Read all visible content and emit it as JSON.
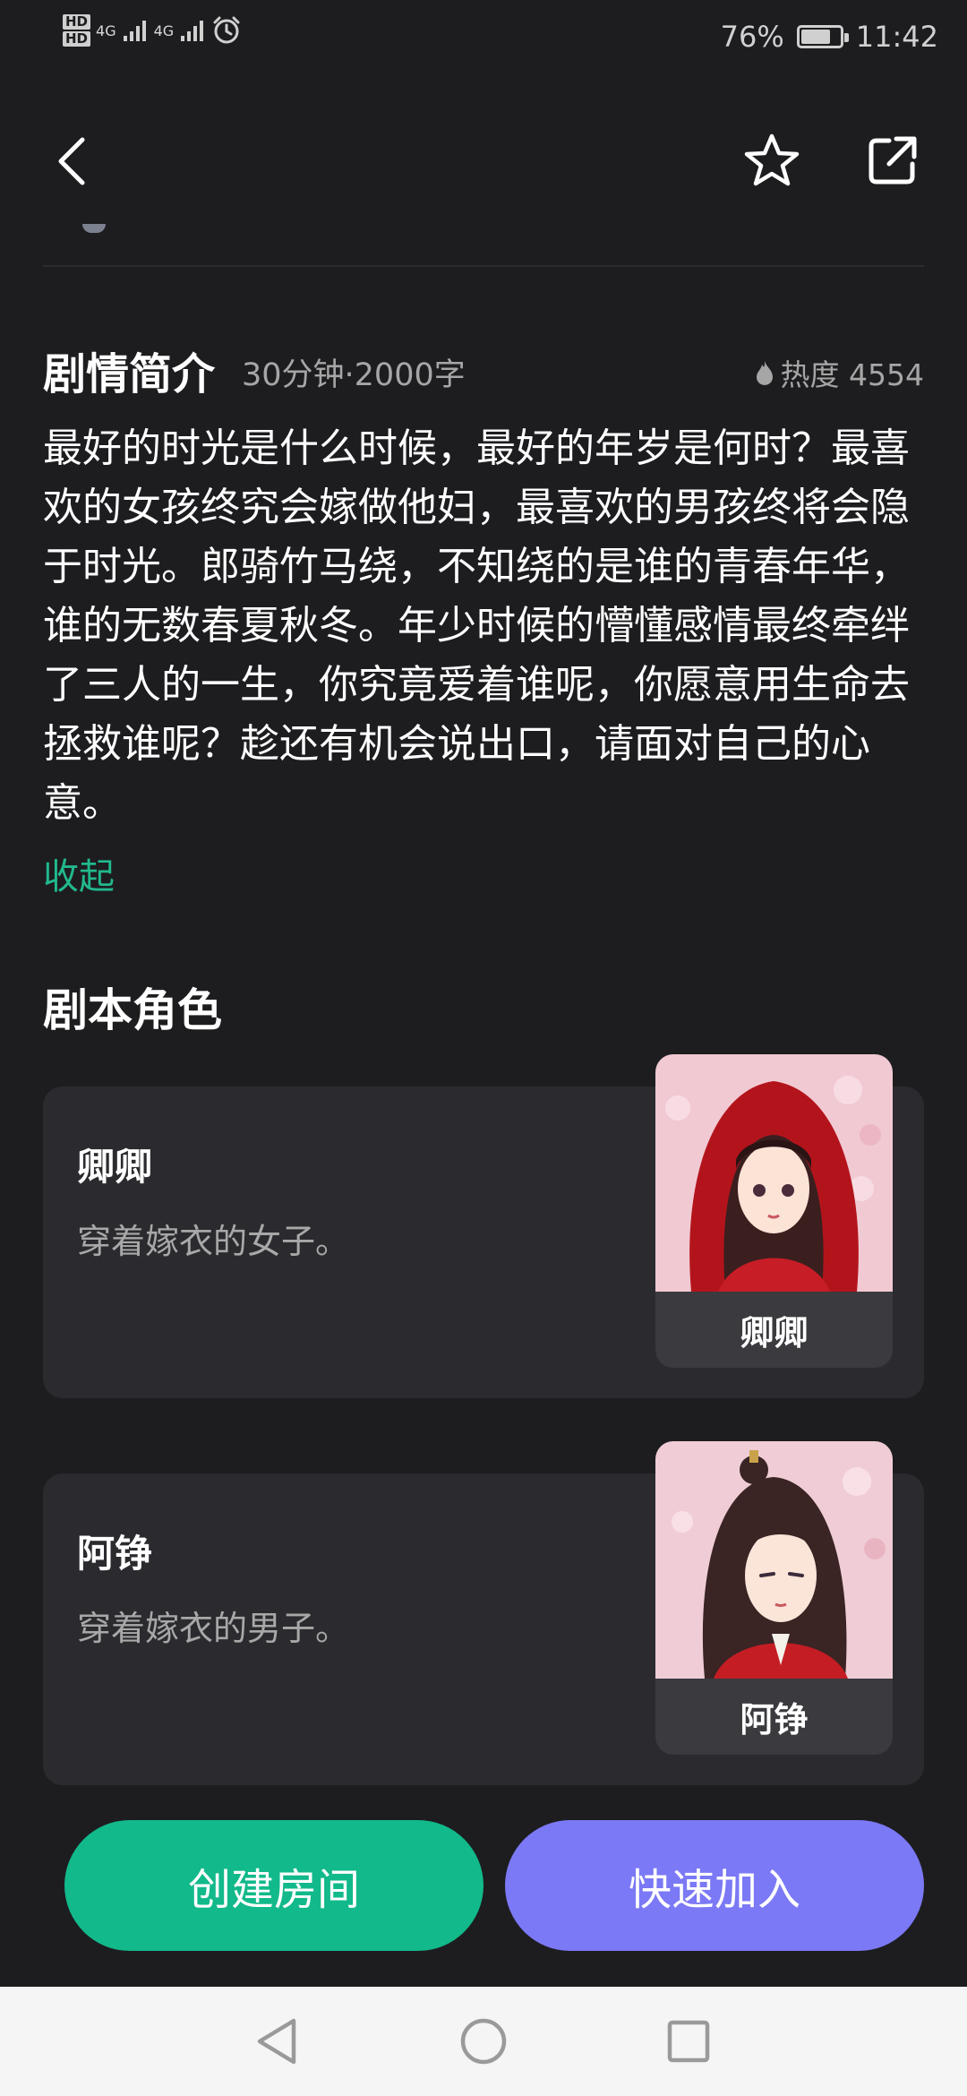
{
  "status_bar": {
    "hd1": "HD",
    "hd2": "HD",
    "network1": "4G",
    "network2": "4G",
    "battery": "76%",
    "battery_level": 0.76,
    "time": "11:42"
  },
  "intro": {
    "title": "剧情简介",
    "meta": "30分钟·2000字",
    "heat_label": "热度 4554",
    "body": "最好的时光是什么时候，最好的年岁是何时？最喜欢的女孩终究会嫁做他妇，最喜欢的男孩终将会隐于时光。郎骑竹马绕，不知绕的是谁的青春年华，谁的无数春夏秋冬。年少时候的懵懂感情最终牵绊了三人的一生，你究竟爱着谁呢，你愿意用生命去拯救谁呢？趁还有机会说出口，请面对自己的心意。",
    "collapse_label": "收起"
  },
  "roles": {
    "title": "剧本角色",
    "items": [
      {
        "name": "卿卿",
        "desc": "穿着嫁衣的女子。",
        "portrait_label": "卿卿"
      },
      {
        "name": "阿铮",
        "desc": "穿着嫁衣的男子。",
        "portrait_label": "阿铮"
      }
    ]
  },
  "actions": {
    "create_label": "创建房间",
    "join_label": "快速加入"
  },
  "colors": {
    "background": "#1d1d20",
    "card": "#2b2b2f",
    "accent_green": "#12b98a",
    "accent_purple": "#7b79f5",
    "link_green": "#21b98d"
  }
}
